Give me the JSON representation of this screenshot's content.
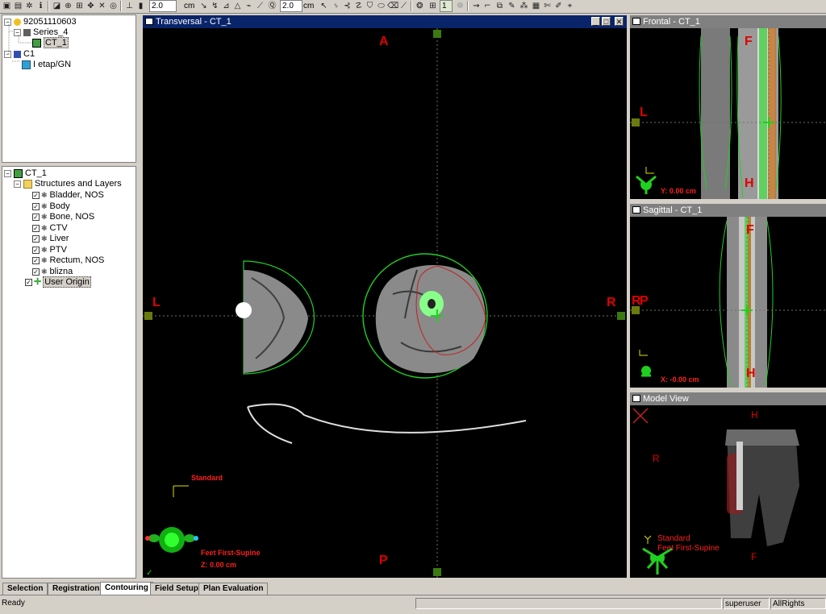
{
  "toolbar": {
    "thickness1": "2.0",
    "unit1": "cm",
    "thickness2": "2.0",
    "unit2": "cm",
    "counter": "1"
  },
  "patient_tree": {
    "patient": "92051110603",
    "series": "Series_4",
    "image": "CT_1",
    "course": "C1",
    "plan": "I etap/GN"
  },
  "structure_tree": {
    "root": "CT_1",
    "group": "Structures and Layers",
    "structures": [
      "Bladder, NOS",
      "Body",
      "Bone, NOS",
      "CTV",
      "Liver",
      "PTV",
      "Rectum, NOS",
      "blizna"
    ],
    "user_origin": "User Origin"
  },
  "transversal": {
    "title": "Transversal - CT_1",
    "anterior": "A",
    "posterior": "P",
    "left": "L",
    "right": "R",
    "orientation_label": "Standard",
    "position_label": "Feet First-Supine",
    "coordinate": "Z: 0.00 cm"
  },
  "frontal": {
    "title": "Frontal - CT_1",
    "top": "F",
    "bottom": "H",
    "left": "L",
    "coordinate": "Y: 0.00 cm"
  },
  "sagittal": {
    "title": "Sagittal - CT_1",
    "top": "F",
    "bottom": "H",
    "side": "P",
    "side2": "R",
    "coordinate": "X: -0.00 cm"
  },
  "model_view": {
    "title": "Model View",
    "top": "H",
    "left": "R",
    "bottom": "F",
    "orientation_label": "Standard",
    "position_label": "Feet First-Supine"
  },
  "tabs": [
    "Selection",
    "Registration",
    "Contouring",
    "Field Setup",
    "Plan Evaluation"
  ],
  "active_tab": "Contouring",
  "status": {
    "message": "Ready",
    "user": "superuser",
    "rights": "AllRights"
  },
  "colors": {
    "contour_green": "#22ee22",
    "contour_red": "#cc2222",
    "label_red": "#e00000",
    "title_active": "#0a246a",
    "title_inactive": "#808080"
  }
}
